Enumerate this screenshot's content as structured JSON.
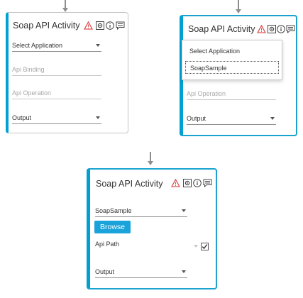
{
  "colors": {
    "accent": "#00a0d2",
    "warning": "#e05252",
    "button": "#1aa3db"
  },
  "cards": [
    {
      "title": "Soap API Activity",
      "icons": [
        "warning-icon",
        "settings-icon",
        "info-icon",
        "comment-icon"
      ],
      "select_application": {
        "placeholder": "Select Application"
      },
      "api_binding": {
        "placeholder": "Api Binding"
      },
      "api_operation": {
        "placeholder": "Api Operation"
      },
      "output": {
        "value": "Output"
      }
    },
    {
      "title": "Soap API Activity",
      "icons": [
        "warning-icon",
        "settings-icon",
        "info-icon",
        "comment-icon"
      ],
      "dropdown": {
        "options": [
          "Select Application",
          "SoapSample"
        ],
        "highlighted": "SoapSample"
      },
      "api_operation": {
        "placeholder": "Api Operation"
      },
      "output": {
        "value": "Output"
      }
    },
    {
      "title": "Soap API Activity",
      "icons": [
        "warning-icon",
        "settings-icon",
        "info-icon",
        "comment-icon"
      ],
      "select_application": {
        "value": "SoapSample"
      },
      "browse_button": {
        "label": "Browse"
      },
      "api_path": {
        "label": "Api Path",
        "checked": true
      },
      "output": {
        "value": "Output"
      }
    }
  ]
}
